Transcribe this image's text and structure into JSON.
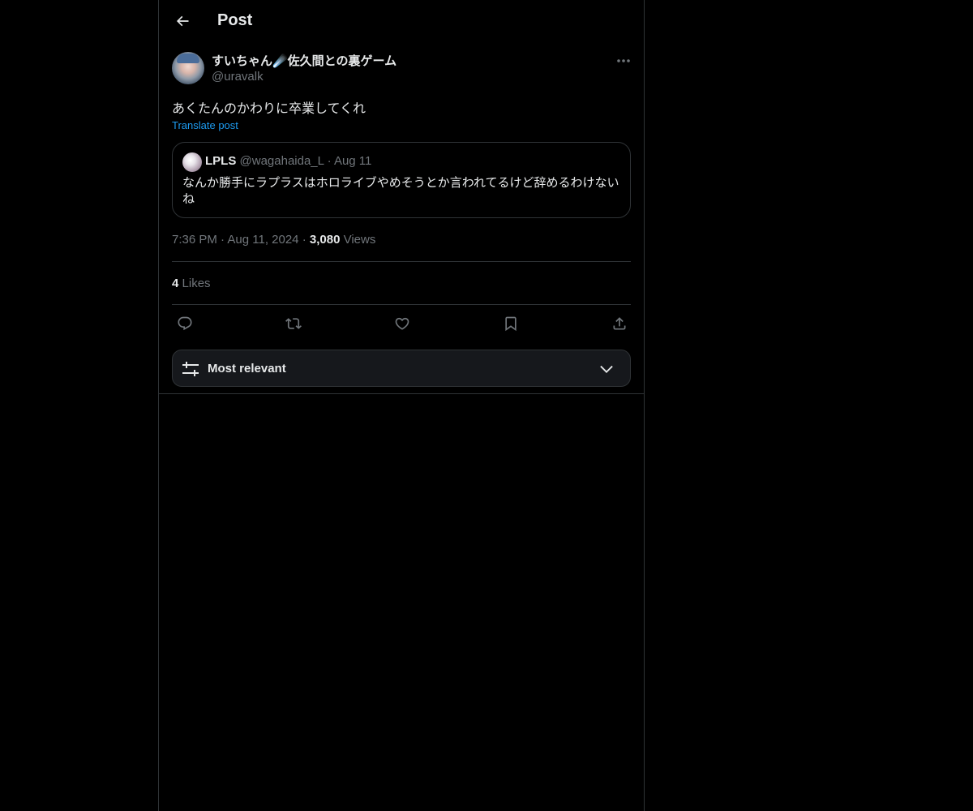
{
  "header": {
    "title": "Post",
    "back_icon": "arrow-left-icon"
  },
  "post": {
    "author_name": "すいちゃん☄️佐久間との裏ゲーム",
    "author_handle": "@uravalk",
    "text": "あくたんのかわりに卒業してくれ",
    "translate_label": "Translate post",
    "time": "7:36 PM",
    "date": "Aug 11, 2024",
    "views_count": "3,080",
    "views_label": "Views",
    "likes_count": "4",
    "likes_label": "Likes",
    "separator": "·"
  },
  "quote": {
    "name": "LPLS",
    "handle": "@wagahaida_L",
    "date": "Aug 11",
    "separator": "·",
    "text": "なんか勝手にラプラスはホロライブやめそうとか言われてるけど辞めるわけないね"
  },
  "actions": [
    "reply-icon",
    "repost-icon",
    "like-icon",
    "bookmark-icon",
    "share-icon"
  ],
  "sort": {
    "label": "Most relevant",
    "icon": "sliders-icon",
    "chevron": "chevron-down-icon"
  },
  "colors": {
    "background": "#000000",
    "text": "#e7e9ea",
    "muted": "#71767b",
    "accent": "#1d9bf0",
    "border": "#2f3336",
    "sort_bg": "#16181c"
  }
}
